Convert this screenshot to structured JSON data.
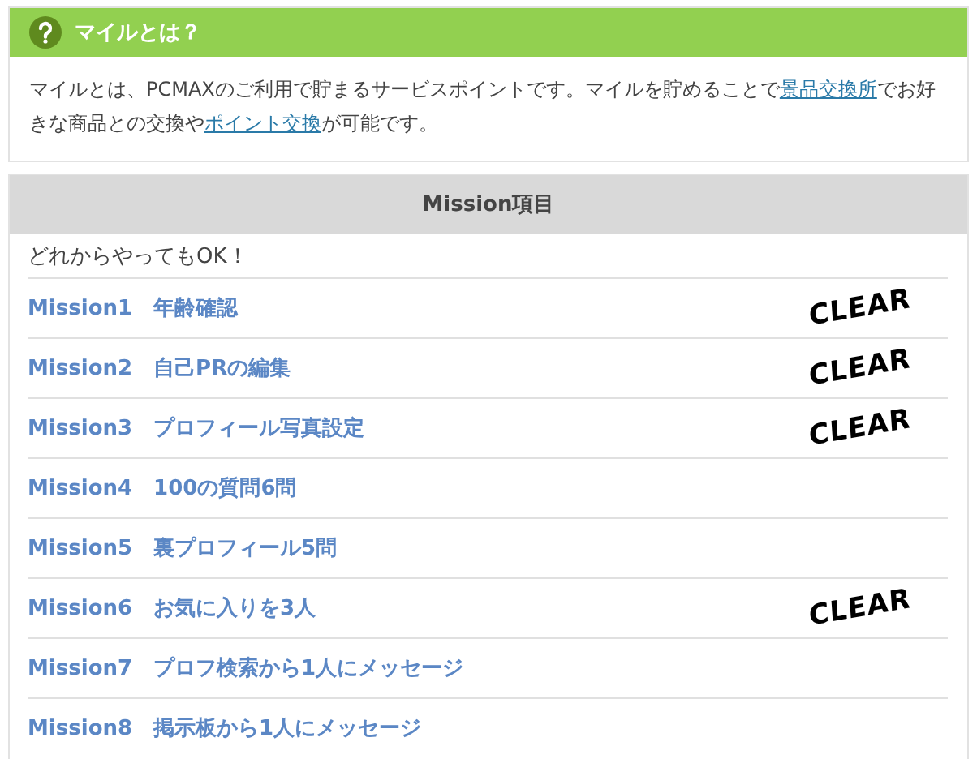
{
  "about": {
    "title": "マイルとは？",
    "paragraph": [
      {
        "text": "マイルとは、PCMAXのご利用で貯まるサービスポイントです。マイルを貯めることで",
        "link": false
      },
      {
        "text": "景品交換所",
        "link": true
      },
      {
        "text": "でお好きな商品との交換や",
        "link": false
      },
      {
        "text": "ポイント交換",
        "link": true
      },
      {
        "text": "が可能です。",
        "link": false
      }
    ]
  },
  "missions": {
    "title": "Mission項目",
    "note": "どれからやってもOK！",
    "items": [
      {
        "label": "Mission1　年齢確認",
        "badge": "CLEAR"
      },
      {
        "label": "Mission2　自己PRの編集",
        "badge": "CLEAR"
      },
      {
        "label": "Mission3　プロフィール写真設定",
        "badge": "CLEAR"
      },
      {
        "label": "Mission4　100の質問6問"
      },
      {
        "label": "Mission5　裏プロフィール5問"
      },
      {
        "label": "Mission6　お気に入りを3人",
        "badge": "CLEAR"
      },
      {
        "label": "Mission7　プロフ検索から1人にメッセージ"
      },
      {
        "label": "Mission8　掲示板から1人にメッセージ"
      }
    ]
  }
}
